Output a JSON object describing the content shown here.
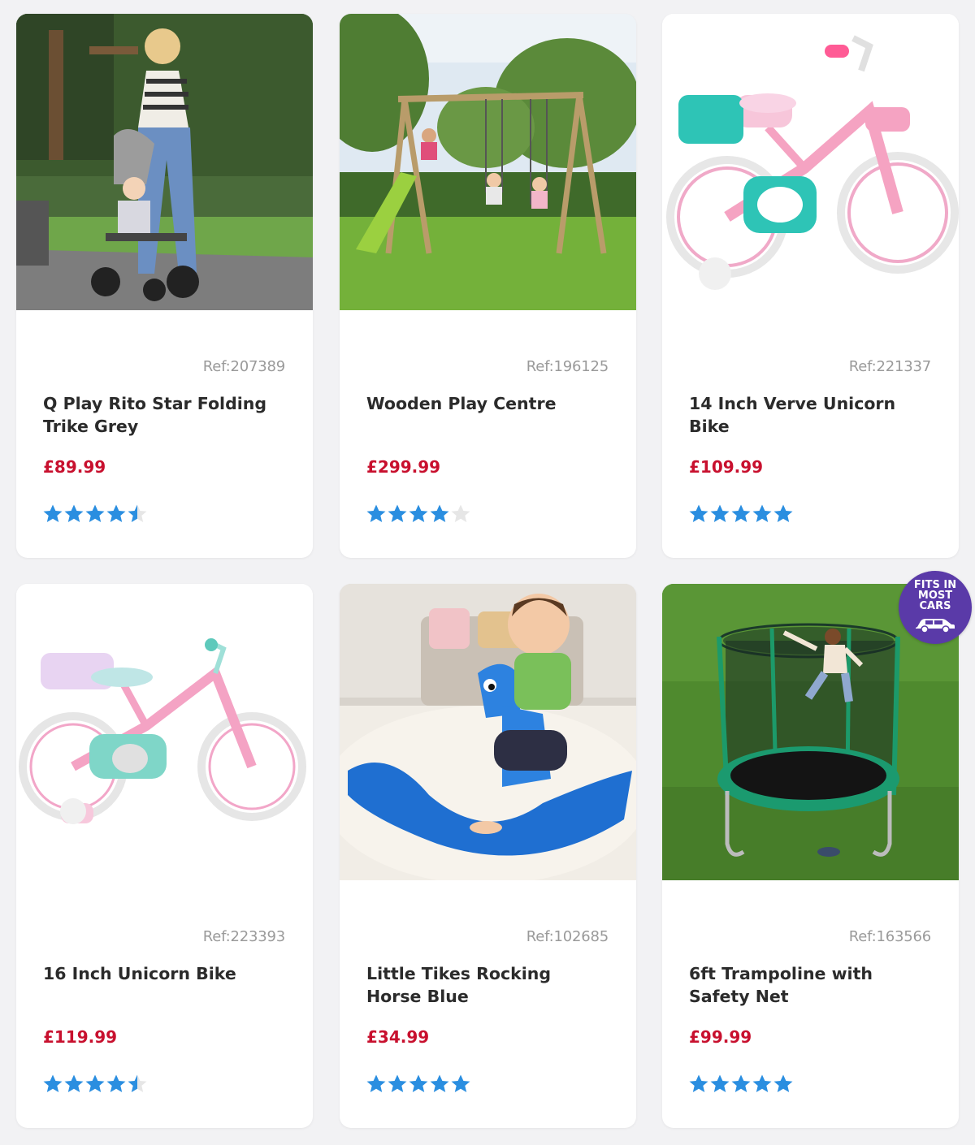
{
  "products": [
    {
      "ref": "Ref:207389",
      "title": "Q Play Rito Star Folding Trike Grey",
      "price": "£89.99",
      "rating": 4.5,
      "image": "trike-photo"
    },
    {
      "ref": "Ref:196125",
      "title": "Wooden Play Centre",
      "price": "£299.99",
      "rating": 4,
      "image": "play-centre-photo"
    },
    {
      "ref": "Ref:221337",
      "title": "14 Inch Verve Unicorn Bike",
      "price": "£109.99",
      "rating": 5,
      "image": "unicorn-bike-14-photo"
    },
    {
      "ref": "Ref:223393",
      "title": "16 Inch Unicorn Bike",
      "price": "£119.99",
      "rating": 4.5,
      "image": "unicorn-bike-16-photo"
    },
    {
      "ref": "Ref:102685",
      "title": "Little Tikes Rocking Horse Blue",
      "price": "£34.99",
      "rating": 5,
      "image": "rocking-horse-photo"
    },
    {
      "ref": "Ref:163566",
      "title": "6ft Trampoline with Safety Net",
      "price": "£99.99",
      "rating": 5,
      "image": "trampoline-photo"
    }
  ],
  "badge": {
    "line1": "FITS IN",
    "line2": "MOST",
    "line3": "CARS",
    "icon": "car-icon"
  },
  "colors": {
    "price": "#c8102e",
    "star": "#2a8ee0",
    "star_empty": "#e6e6e6",
    "badge": "#5a3aa8"
  }
}
